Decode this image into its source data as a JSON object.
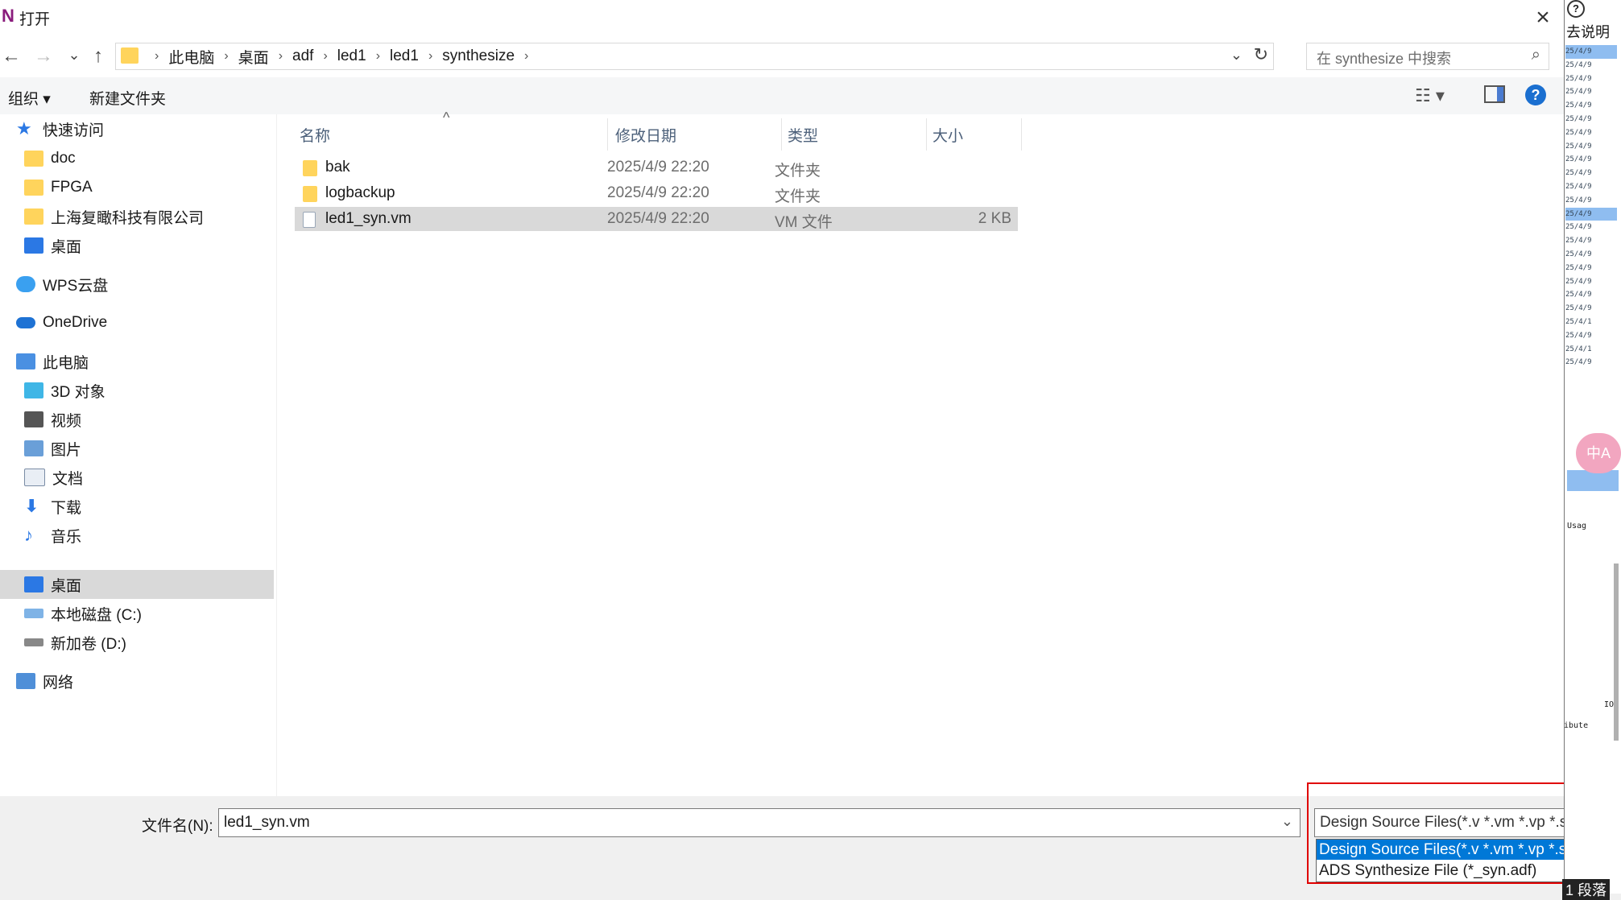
{
  "window": {
    "title": "打开",
    "app_icon": "N"
  },
  "nav": {
    "back": "←",
    "forward": "→",
    "history": "⌄",
    "up": "↑"
  },
  "address": {
    "crumbs": [
      "此电脑",
      "桌面",
      "adf",
      "led1",
      "led1",
      "synthesize"
    ],
    "separator": "›"
  },
  "search": {
    "placeholder": "在 synthesize 中搜索"
  },
  "toolbar": {
    "organize": "组织 ▾",
    "new_folder": "新建文件夹",
    "help": "?"
  },
  "sidebar": {
    "items": [
      {
        "label": "快速访问",
        "icon": "star-icon"
      },
      {
        "label": "doc",
        "icon": "folder-icon"
      },
      {
        "label": "FPGA",
        "icon": "folder-icon"
      },
      {
        "label": "上海复瞰科技有限公司",
        "icon": "folder-icon"
      },
      {
        "label": "桌面",
        "icon": "desktop-icon"
      },
      {
        "label": "WPS云盘",
        "icon": "cloud-icon"
      },
      {
        "label": "OneDrive",
        "icon": "onedrive-icon"
      },
      {
        "label": "此电脑",
        "icon": "computer-icon"
      },
      {
        "label": "3D 对象",
        "icon": "cube-icon"
      },
      {
        "label": "视频",
        "icon": "video-icon"
      },
      {
        "label": "图片",
        "icon": "picture-icon"
      },
      {
        "label": "文档",
        "icon": "document-icon"
      },
      {
        "label": "下载",
        "icon": "download-icon"
      },
      {
        "label": "音乐",
        "icon": "music-icon"
      },
      {
        "label": "桌面",
        "icon": "desktop-icon"
      },
      {
        "label": "本地磁盘 (C:)",
        "icon": "disk-icon"
      },
      {
        "label": "新加卷 (D:)",
        "icon": "disk-icon"
      },
      {
        "label": "网络",
        "icon": "network-icon"
      }
    ],
    "selected_index": 14
  },
  "columns": {
    "name": "名称",
    "date": "修改日期",
    "type": "类型",
    "size": "大小"
  },
  "files": [
    {
      "name": "bak",
      "date": "2025/4/9 22:20",
      "type": "文件夹",
      "size": ""
    },
    {
      "name": "logbackup",
      "date": "2025/4/9 22:20",
      "type": "文件夹",
      "size": ""
    },
    {
      "name": "led1_syn.vm",
      "date": "2025/4/9 22:20",
      "type": "VM 文件",
      "size": "2 KB"
    }
  ],
  "bottom": {
    "filename_label": "文件名(N):",
    "filename_value": "led1_syn.vm",
    "filter_value": "Design Source Files(*.v *.vm *.vp *.sv *.svp *",
    "filter_options": [
      "Design Source Files(*.v *.vm *.vp *.sv *.svp *",
      "ADS Synthesize File (*_syn.adf)"
    ],
    "filter_selected": 0
  },
  "background_window": {
    "help_label": "去说明",
    "date_rows": [
      "25/4/9",
      "25/4/9",
      "25/4/9",
      "25/4/9",
      "25/4/9",
      "25/4/9",
      "25/4/9",
      "25/4/9",
      "25/4/9",
      "25/4/9",
      "25/4/9",
      "25/4/9",
      "25/4/9",
      "25/4/9",
      "25/4/9",
      "25/4/9",
      "25/4/9",
      "25/4/9",
      "25/4/9",
      "25/4/9",
      "25/4/1",
      "25/4/9",
      "25/4/1",
      "25/4/9"
    ],
    "highlight_rows": [
      0,
      12
    ],
    "translate_label": "中A",
    "usage_label": "Usag",
    "io_label": "IO",
    "ibute_label": "ibute",
    "footer_label": "1 段落"
  }
}
